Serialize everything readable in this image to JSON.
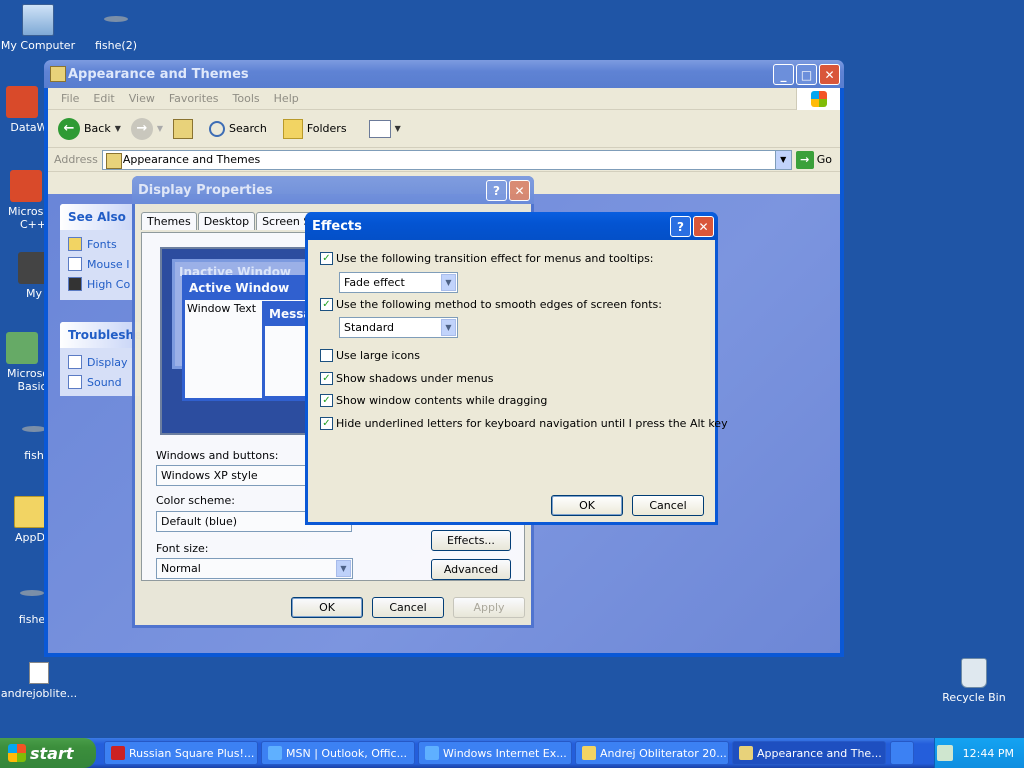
{
  "desktop": {
    "icons": [
      {
        "label": "My Computer"
      },
      {
        "label": "fishe(2)"
      },
      {
        "label": "DataWa"
      },
      {
        "label": "Microsoft C++"
      },
      {
        "label": "My"
      },
      {
        "label": "Microsoft Basic"
      },
      {
        "label": "fish"
      },
      {
        "label": "AppD"
      },
      {
        "label": "fishe"
      },
      {
        "label": "andrejoblite..."
      },
      {
        "label": "Recycle Bin"
      }
    ]
  },
  "explorer": {
    "title": "Appearance and Themes",
    "menu": [
      "File",
      "Edit",
      "View",
      "Favorites",
      "Tools",
      "Help"
    ],
    "toolbar": {
      "back": "Back",
      "search": "Search",
      "folders": "Folders"
    },
    "address": {
      "label": "Address",
      "value": "Appearance and Themes",
      "go": "Go"
    },
    "see_also": {
      "title": "See Also",
      "links": [
        "Fonts",
        "Mouse I",
        "High Co"
      ]
    },
    "troubleshoot": {
      "title": "Troubleshe",
      "links": [
        "Display",
        "Sound"
      ]
    }
  },
  "display_properties": {
    "title": "Display Properties",
    "tabs": [
      "Themes",
      "Desktop",
      "Screen Sav"
    ],
    "preview": {
      "inactive": "Inactive Window",
      "active": "Active Window",
      "window_text": "Window Text",
      "message": "Messag"
    },
    "windows_buttons_label": "Windows and buttons:",
    "windows_buttons_value": "Windows XP style",
    "color_scheme_label": "Color scheme:",
    "color_scheme_value": "Default (blue)",
    "font_size_label": "Font size:",
    "font_size_value": "Normal",
    "effects_btn": "Effects...",
    "advanced_btn": "Advanced",
    "ok": "OK",
    "cancel": "Cancel",
    "apply": "Apply"
  },
  "effects": {
    "title": "Effects",
    "transition": {
      "label": "Use the following transition effect for menus and tooltips:",
      "checked": true,
      "value": "Fade effect"
    },
    "smoothing": {
      "label": "Use the following method to smooth edges of screen fonts:",
      "checked": true,
      "value": "Standard"
    },
    "large_icons": {
      "label": "Use large icons",
      "checked": false
    },
    "shadows": {
      "label": "Show shadows under menus",
      "checked": true
    },
    "drag_contents": {
      "label": "Show window contents while dragging",
      "checked": true
    },
    "hide_underline": {
      "label": "Hide underlined letters for keyboard navigation until I press the Alt key",
      "checked": true
    },
    "ok": "OK",
    "cancel": "Cancel"
  },
  "taskbar": {
    "start": "start",
    "tasks": [
      "Russian Square Plus!...",
      "MSN | Outlook, Offic...",
      "Windows Internet Ex...",
      "Andrej Obliterator 20...",
      "Appearance and The..."
    ],
    "clock": "12:44 PM"
  },
  "colors": {
    "desktop": "#1f55a6",
    "xp_blue": "#0a58d6",
    "dialog_face": "#ece9d8",
    "start_green": "#3c8f3c"
  }
}
